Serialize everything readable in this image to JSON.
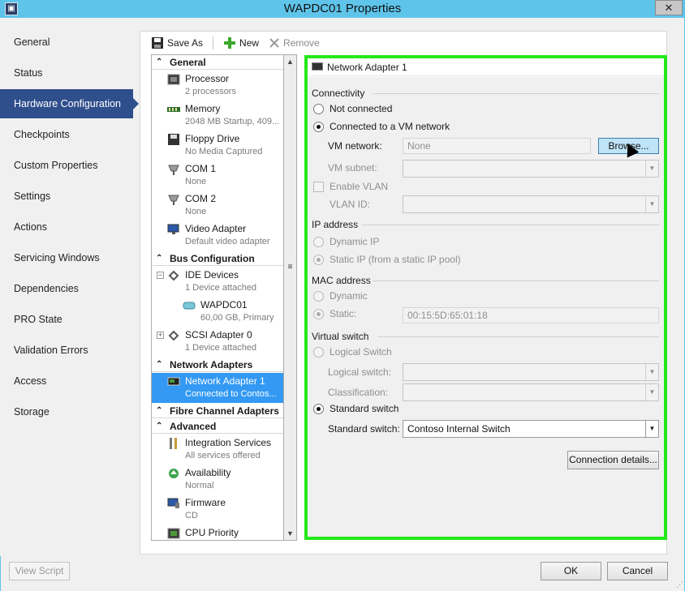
{
  "window": {
    "title": "WAPDC01 Properties",
    "close_label": "✕"
  },
  "nav": {
    "items": [
      {
        "label": "General",
        "selected": false
      },
      {
        "label": "Status",
        "selected": false
      },
      {
        "label": "Hardware Configuration",
        "selected": true
      },
      {
        "label": "Checkpoints",
        "selected": false
      },
      {
        "label": "Custom Properties",
        "selected": false
      },
      {
        "label": "Settings",
        "selected": false
      },
      {
        "label": "Actions",
        "selected": false
      },
      {
        "label": "Servicing Windows",
        "selected": false
      },
      {
        "label": "Dependencies",
        "selected": false
      },
      {
        "label": "PRO State",
        "selected": false
      },
      {
        "label": "Validation Errors",
        "selected": false
      },
      {
        "label": "Access",
        "selected": false
      },
      {
        "label": "Storage",
        "selected": false
      }
    ]
  },
  "toolbar": {
    "save_as": "Save As",
    "new": "New",
    "remove": "Remove"
  },
  "tree": {
    "sections": {
      "general": "General",
      "bus": "Bus Configuration",
      "network": "Network Adapters",
      "fibre": "Fibre Channel Adapters",
      "advanced": "Advanced"
    },
    "items": {
      "processor": {
        "title": "Processor",
        "sub": "2 processors"
      },
      "memory": {
        "title": "Memory",
        "sub": "2048 MB Startup, 409..."
      },
      "floppy": {
        "title": "Floppy Drive",
        "sub": "No Media Captured"
      },
      "com1": {
        "title": "COM 1",
        "sub": "None"
      },
      "com2": {
        "title": "COM 2",
        "sub": "None"
      },
      "video": {
        "title": "Video Adapter",
        "sub": "Default video adapter"
      },
      "ide": {
        "title": "IDE Devices",
        "sub": "1 Device attached"
      },
      "wapdc": {
        "title": "WAPDC01",
        "sub": "60,00 GB, Primary"
      },
      "scsi": {
        "title": "SCSI Adapter 0",
        "sub": "1 Device attached"
      },
      "netadapter": {
        "title": "Network Adapter 1",
        "sub": "Connected to Contos..."
      },
      "integration": {
        "title": "Integration Services",
        "sub": "All services offered"
      },
      "availability": {
        "title": "Availability",
        "sub": "Normal"
      },
      "firmware": {
        "title": "Firmware",
        "sub": "CD"
      },
      "cpu_priority": {
        "title": "CPU Priority",
        "sub": ""
      }
    }
  },
  "panel": {
    "title": "Network Adapter 1",
    "connectivity": {
      "group": "Connectivity",
      "not_connected": "Not connected",
      "connected_vm": "Connected to a VM network",
      "vm_network_label": "VM network:",
      "vm_network_value": "None",
      "browse": "Browse...",
      "vm_subnet_label": "VM subnet:",
      "enable_vlan": "Enable VLAN",
      "vlan_id_label": "VLAN ID:"
    },
    "ip": {
      "group": "IP address",
      "dynamic": "Dynamic IP",
      "static": "Static IP (from a static IP pool)"
    },
    "mac": {
      "group": "MAC address",
      "dynamic": "Dynamic",
      "static": "Static:",
      "static_value": "00:15:5D:65:01:18"
    },
    "vswitch": {
      "group": "Virtual switch",
      "logical": "Logical Switch",
      "logical_label": "Logical switch:",
      "classification_label": "Classification:",
      "standard": "Standard switch",
      "standard_label": "Standard switch:",
      "standard_value": "Contoso Internal Switch"
    },
    "connection_details": "Connection details..."
  },
  "footer": {
    "view_script": "View Script",
    "ok": "OK",
    "cancel": "Cancel"
  }
}
